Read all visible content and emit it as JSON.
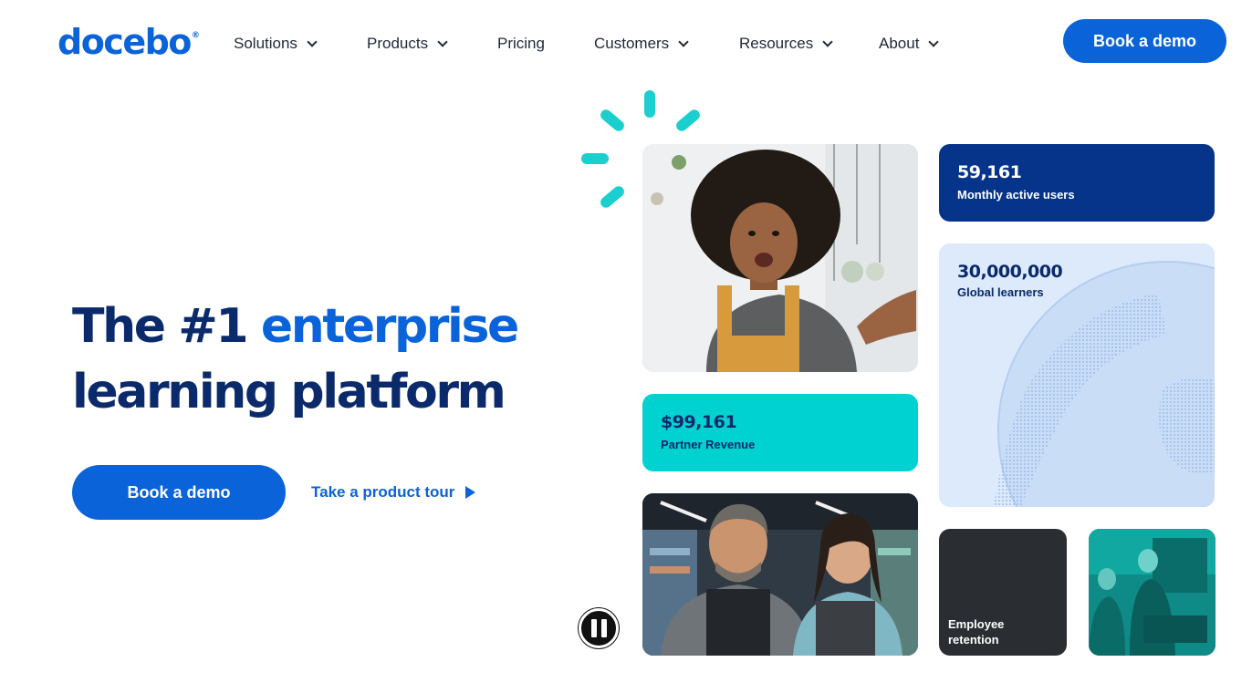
{
  "brand": {
    "logo_text": "docebo",
    "registered_mark": "®"
  },
  "nav": {
    "items": [
      {
        "label": "Solutions",
        "has_dropdown": true
      },
      {
        "label": "Products",
        "has_dropdown": true
      },
      {
        "label": "Pricing",
        "has_dropdown": false
      },
      {
        "label": "Customers",
        "has_dropdown": true
      },
      {
        "label": "Resources",
        "has_dropdown": true
      },
      {
        "label": "About",
        "has_dropdown": true
      }
    ],
    "cta_label": "Book a demo"
  },
  "hero": {
    "title_part1": "The #1 ",
    "title_accent": "enterprise",
    "title_part2": "learning platform",
    "primary_cta": "Book a demo",
    "secondary_cta": "Take a product tour"
  },
  "stats": {
    "monthly_users": {
      "value": "59,161",
      "label": "Monthly active users"
    },
    "global_learners": {
      "value": "30,000,000",
      "label": "Global learners"
    },
    "partner_revenue": {
      "value": "$99,161",
      "label": "Partner Revenue"
    },
    "employee_retention": {
      "label_line1": "Employee",
      "label_line2": "retention"
    }
  },
  "colors": {
    "brand_blue": "#0a63d8",
    "navy": "#0b2a6b",
    "dark_blue_card": "#06348a",
    "teal": "#00d2d2",
    "light_blue_card": "#dceafc",
    "charcoal_card": "#2a2e33"
  },
  "media_controls": {
    "pause_icon": "pause-icon"
  }
}
